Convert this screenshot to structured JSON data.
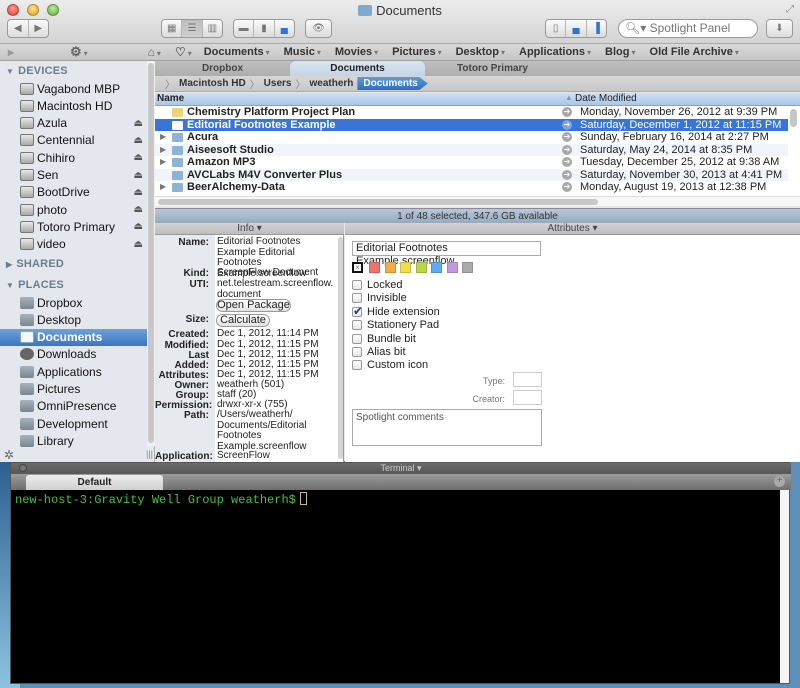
{
  "window": {
    "title": "Documents"
  },
  "toolbar": {
    "back_label": "◀",
    "forward_label": "▶",
    "view_icons": [
      "icon-view-icon",
      "list-view-icon",
      "column-view-icon"
    ],
    "layout_icons": [
      "coverflow-icon",
      "split-icon",
      "preview-bottom-icon"
    ],
    "quicklook_label": "👁",
    "panel_icons": [
      "sidebar-toggle-icon",
      "info-panel-icon",
      "attributes-panel-icon"
    ],
    "search_placeholder": "Spotlight Panel",
    "download_label": "⬇"
  },
  "favbar": {
    "items": [
      "Documents",
      "Music",
      "Movies",
      "Pictures",
      "Desktop",
      "Applications",
      "Blog",
      "Old File Archive"
    ]
  },
  "sidebar": {
    "devices_heading": "DEVICES",
    "devices": [
      {
        "label": "Vagabond MBP",
        "eject": false
      },
      {
        "label": "Macintosh HD",
        "eject": false
      },
      {
        "label": "Azula",
        "eject": true
      },
      {
        "label": "Centennial",
        "eject": true
      },
      {
        "label": "Chihiro",
        "eject": true
      },
      {
        "label": "Sen",
        "eject": true
      },
      {
        "label": "BootDrive",
        "eject": true
      },
      {
        "label": "photo",
        "eject": true
      },
      {
        "label": "Totoro Primary",
        "eject": true
      },
      {
        "label": "video",
        "eject": true
      }
    ],
    "shared_heading": "SHARED",
    "places_heading": "PLACES",
    "places": [
      {
        "label": "Dropbox"
      },
      {
        "label": "Desktop"
      },
      {
        "label": "Documents",
        "selected": true
      },
      {
        "label": "Downloads"
      },
      {
        "label": "Applications"
      },
      {
        "label": "Pictures"
      },
      {
        "label": "OmniPresence"
      },
      {
        "label": "Development"
      },
      {
        "label": "Library"
      }
    ],
    "eject_glyph": "⏏"
  },
  "tabs": [
    "Dropbox",
    "Documents",
    "Totoro Primary"
  ],
  "path": [
    "Macintosh HD",
    "Users",
    "weatherh",
    "Documents"
  ],
  "list": {
    "col_name": "Name",
    "col_date": "Date Modified",
    "rows": [
      {
        "name": "Chemistry Platform Project Plan",
        "date": "Monday, November 26, 2012 at 9:39 PM",
        "folder": false,
        "expandable": false
      },
      {
        "name": "Editorial Footnotes Example",
        "date": "Saturday, December 1, 2012 at 11:15 PM",
        "folder": false,
        "expandable": false,
        "selected": true
      },
      {
        "name": "Acura",
        "date": "Sunday, February 16, 2014 at 2:27 PM",
        "folder": true,
        "expandable": true
      },
      {
        "name": "Aiseesoft Studio",
        "date": "Saturday, May 24, 2014 at 8:35 PM",
        "folder": true,
        "expandable": true
      },
      {
        "name": "Amazon MP3",
        "date": "Tuesday, December 25, 2012 at 9:38 AM",
        "folder": true,
        "expandable": true
      },
      {
        "name": "AVCLabs M4V Converter Plus",
        "date": "Saturday, November 30, 2013 at 4:41 PM",
        "folder": true,
        "expandable": false
      },
      {
        "name": "BeerAlchemy-Data",
        "date": "Monday, August 19, 2013 at 12:38 PM",
        "folder": true,
        "expandable": true
      }
    ]
  },
  "status": "1 of 48 selected, 347.6 GB available",
  "info": {
    "heading": "Info",
    "name_label": "Name:",
    "name_value": "Editorial Footnotes Example Editorial Footnotes Example.screenflow",
    "kind_label": "Kind:",
    "kind_value": "ScreenFlow Document",
    "uti_label": "UTI:",
    "uti_value": "net.telestream.screenflow.document",
    "open_package": "Open Package",
    "size_label": "Size:",
    "calculate": "Calculate",
    "created_label": "Created:",
    "created_value": "Dec 1, 2012, 11:14 PM",
    "modified_label": "Modified:",
    "modified_value": "Dec 1, 2012, 11:15 PM",
    "lastopened_label": "Last Opened:",
    "lastopened_value": "Dec 1, 2012, 11:15 PM",
    "added_label": "Added:",
    "added_value": "Dec 1, 2012, 11:15 PM",
    "attributes_label": "Attributes:",
    "attributes_value": "Dec 1, 2012, 11:15 PM",
    "owner_label": "Owner:",
    "owner_value": "weatherh (501)",
    "group_label": "Group:",
    "group_value": "staff (20)",
    "permission_label": "Permission:",
    "permission_value": "drwxr-xr-x (755)",
    "path_label": "Path:",
    "path_value": "/Users/weatherh/ Documents/Editorial Footnotes Example.screenflow",
    "application_label": "Application:",
    "application_value": "ScreenFlow"
  },
  "attributes": {
    "heading": "Attributes",
    "filename": "Editorial Footnotes Example.screenflow",
    "label_colors": [
      "#f0736b",
      "#f3ab47",
      "#f1dc4e",
      "#b8d64b",
      "#5eabf3",
      "#c39ae0",
      "#ababab"
    ],
    "checkboxes": [
      {
        "label": "Locked",
        "checked": false
      },
      {
        "label": "Invisible",
        "checked": false
      },
      {
        "label": "Hide extension",
        "checked": true
      },
      {
        "label": "Stationery Pad",
        "checked": false
      },
      {
        "label": "Bundle bit",
        "checked": false
      },
      {
        "label": "Alias bit",
        "checked": false
      },
      {
        "label": "Custom icon",
        "checked": false
      }
    ],
    "type_label": "Type:",
    "type_value": "",
    "creator_label": "Creator:",
    "creator_value": "",
    "comments_placeholder": "Spotlight comments"
  },
  "terminal": {
    "title": "Terminal",
    "tab": "Default",
    "prompt": "new-host-3:Gravity Well Group weatherh$"
  }
}
